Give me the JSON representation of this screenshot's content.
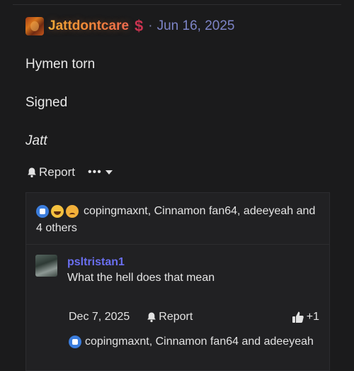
{
  "post": {
    "username": "Jattdontcare",
    "badge_icon": "dollar-icon",
    "separator": "·",
    "date": "Jun 16, 2025",
    "lines": [
      "Hymen torn",
      "Signed",
      "Jatt"
    ],
    "report_label": "Report",
    "more_label": "•••"
  },
  "reactions": {
    "icons": [
      "like-icon",
      "laugh-icon",
      "sad-icon"
    ],
    "summary": "copingmaxnt, Cinnamon fan64, adeeyeah and 4 others"
  },
  "reply": {
    "username": "psltristan1",
    "text": "What the hell does that mean",
    "date": "Dec 7, 2025",
    "report_label": "Report",
    "like_count": "+1",
    "reactions_summary": "copingmaxnt, Cinnamon fan64 and adeeyeah"
  },
  "colors": {
    "background": "#1b1b1c",
    "date": "#7d84c7",
    "reply_user": "#6a6ff0",
    "like_blue": "#3b7ddd"
  }
}
